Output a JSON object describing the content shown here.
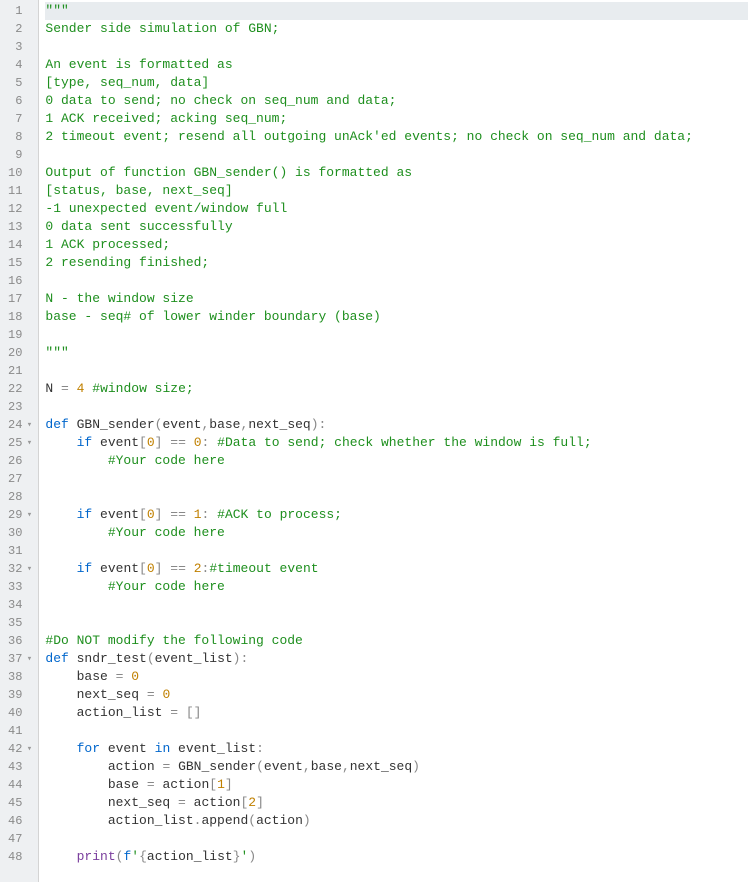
{
  "lines": [
    {
      "num": 1,
      "fold": "",
      "tokens": [
        [
          "str",
          "\"\"\""
        ]
      ]
    },
    {
      "num": 2,
      "fold": "",
      "tokens": [
        [
          "str",
          "Sender side simulation of GBN;"
        ]
      ]
    },
    {
      "num": 3,
      "fold": "",
      "tokens": [
        [
          "str",
          ""
        ]
      ]
    },
    {
      "num": 4,
      "fold": "",
      "tokens": [
        [
          "str",
          "An event is formatted as"
        ]
      ]
    },
    {
      "num": 5,
      "fold": "",
      "tokens": [
        [
          "str",
          "[type, seq_num, data]"
        ]
      ]
    },
    {
      "num": 6,
      "fold": "",
      "tokens": [
        [
          "str",
          "0 data to send; no check on seq_num and data;"
        ]
      ]
    },
    {
      "num": 7,
      "fold": "",
      "tokens": [
        [
          "str",
          "1 ACK received; acking seq_num;"
        ]
      ]
    },
    {
      "num": 8,
      "fold": "",
      "tokens": [
        [
          "str",
          "2 timeout event; resend all outgoing unAck'ed events; no check on seq_num and data;"
        ]
      ]
    },
    {
      "num": 9,
      "fold": "",
      "tokens": [
        [
          "str",
          ""
        ]
      ]
    },
    {
      "num": 10,
      "fold": "",
      "tokens": [
        [
          "str",
          "Output of function GBN_sender() is formatted as"
        ]
      ]
    },
    {
      "num": 11,
      "fold": "",
      "tokens": [
        [
          "str",
          "[status, base, next_seq]"
        ]
      ]
    },
    {
      "num": 12,
      "fold": "",
      "tokens": [
        [
          "str",
          "-1 unexpected event/window full"
        ]
      ]
    },
    {
      "num": 13,
      "fold": "",
      "tokens": [
        [
          "str",
          "0 data sent successfully"
        ]
      ]
    },
    {
      "num": 14,
      "fold": "",
      "tokens": [
        [
          "str",
          "1 ACK processed;"
        ]
      ]
    },
    {
      "num": 15,
      "fold": "",
      "tokens": [
        [
          "str",
          "2 resending finished;"
        ]
      ]
    },
    {
      "num": 16,
      "fold": "",
      "tokens": [
        [
          "str",
          ""
        ]
      ]
    },
    {
      "num": 17,
      "fold": "",
      "tokens": [
        [
          "str",
          "N - the window size"
        ]
      ]
    },
    {
      "num": 18,
      "fold": "",
      "tokens": [
        [
          "str",
          "base - seq# of lower winder boundary (base)"
        ]
      ]
    },
    {
      "num": 19,
      "fold": "",
      "tokens": [
        [
          "str",
          ""
        ]
      ]
    },
    {
      "num": 20,
      "fold": "",
      "tokens": [
        [
          "str",
          "\"\"\""
        ]
      ]
    },
    {
      "num": 21,
      "fold": "",
      "tokens": []
    },
    {
      "num": 22,
      "fold": "",
      "tokens": [
        [
          "var",
          "N "
        ],
        [
          "op",
          "="
        ],
        [
          "var",
          " "
        ],
        [
          "num",
          "4"
        ],
        [
          "var",
          " "
        ],
        [
          "comment",
          "#window size;"
        ]
      ]
    },
    {
      "num": 23,
      "fold": "",
      "tokens": []
    },
    {
      "num": 24,
      "fold": "▾",
      "tokens": [
        [
          "kw",
          "def"
        ],
        [
          "var",
          " "
        ],
        [
          "fn",
          "GBN_sender"
        ],
        [
          "paren",
          "("
        ],
        [
          "var",
          "event"
        ],
        [
          "op",
          ","
        ],
        [
          "var",
          "base"
        ],
        [
          "op",
          ","
        ],
        [
          "var",
          "next_seq"
        ],
        [
          "paren",
          ")"
        ],
        [
          "op",
          ":"
        ]
      ]
    },
    {
      "num": 25,
      "fold": "▾",
      "tokens": [
        [
          "var",
          "    "
        ],
        [
          "kw",
          "if"
        ],
        [
          "var",
          " event"
        ],
        [
          "bracket",
          "["
        ],
        [
          "num",
          "0"
        ],
        [
          "bracket",
          "]"
        ],
        [
          "var",
          " "
        ],
        [
          "op",
          "=="
        ],
        [
          "var",
          " "
        ],
        [
          "num",
          "0"
        ],
        [
          "op",
          ":"
        ],
        [
          "var",
          " "
        ],
        [
          "comment",
          "#Data to send; check whether the window is full;"
        ]
      ]
    },
    {
      "num": 26,
      "fold": "",
      "tokens": [
        [
          "var",
          "        "
        ],
        [
          "comment",
          "#Your code here"
        ]
      ]
    },
    {
      "num": 27,
      "fold": "",
      "tokens": []
    },
    {
      "num": 28,
      "fold": "",
      "tokens": []
    },
    {
      "num": 29,
      "fold": "▾",
      "tokens": [
        [
          "var",
          "    "
        ],
        [
          "kw",
          "if"
        ],
        [
          "var",
          " event"
        ],
        [
          "bracket",
          "["
        ],
        [
          "num",
          "0"
        ],
        [
          "bracket",
          "]"
        ],
        [
          "var",
          " "
        ],
        [
          "op",
          "=="
        ],
        [
          "var",
          " "
        ],
        [
          "num",
          "1"
        ],
        [
          "op",
          ":"
        ],
        [
          "var",
          " "
        ],
        [
          "comment",
          "#ACK to process;"
        ]
      ]
    },
    {
      "num": 30,
      "fold": "",
      "tokens": [
        [
          "var",
          "        "
        ],
        [
          "comment",
          "#Your code here"
        ]
      ]
    },
    {
      "num": 31,
      "fold": "",
      "tokens": []
    },
    {
      "num": 32,
      "fold": "▾",
      "tokens": [
        [
          "var",
          "    "
        ],
        [
          "kw",
          "if"
        ],
        [
          "var",
          " event"
        ],
        [
          "bracket",
          "["
        ],
        [
          "num",
          "0"
        ],
        [
          "bracket",
          "]"
        ],
        [
          "var",
          " "
        ],
        [
          "op",
          "=="
        ],
        [
          "var",
          " "
        ],
        [
          "num",
          "2"
        ],
        [
          "op",
          ":"
        ],
        [
          "comment",
          "#timeout event"
        ]
      ]
    },
    {
      "num": 33,
      "fold": "",
      "tokens": [
        [
          "var",
          "        "
        ],
        [
          "comment",
          "#Your code here"
        ]
      ]
    },
    {
      "num": 34,
      "fold": "",
      "tokens": []
    },
    {
      "num": 35,
      "fold": "",
      "tokens": []
    },
    {
      "num": 36,
      "fold": "",
      "tokens": [
        [
          "comment",
          "#Do NOT modify the following code"
        ]
      ]
    },
    {
      "num": 37,
      "fold": "▾",
      "tokens": [
        [
          "kw",
          "def"
        ],
        [
          "var",
          " "
        ],
        [
          "fn",
          "sndr_test"
        ],
        [
          "paren",
          "("
        ],
        [
          "var",
          "event_list"
        ],
        [
          "paren",
          ")"
        ],
        [
          "op",
          ":"
        ]
      ]
    },
    {
      "num": 38,
      "fold": "",
      "tokens": [
        [
          "var",
          "    base "
        ],
        [
          "op",
          "="
        ],
        [
          "var",
          " "
        ],
        [
          "num",
          "0"
        ]
      ]
    },
    {
      "num": 39,
      "fold": "",
      "tokens": [
        [
          "var",
          "    next_seq "
        ],
        [
          "op",
          "="
        ],
        [
          "var",
          " "
        ],
        [
          "num",
          "0"
        ]
      ]
    },
    {
      "num": 40,
      "fold": "",
      "tokens": [
        [
          "var",
          "    action_list "
        ],
        [
          "op",
          "="
        ],
        [
          "var",
          " "
        ],
        [
          "bracket",
          "[]"
        ]
      ]
    },
    {
      "num": 41,
      "fold": "",
      "tokens": []
    },
    {
      "num": 42,
      "fold": "▾",
      "tokens": [
        [
          "var",
          "    "
        ],
        [
          "kw",
          "for"
        ],
        [
          "var",
          " event "
        ],
        [
          "kw",
          "in"
        ],
        [
          "var",
          " event_list"
        ],
        [
          "op",
          ":"
        ]
      ]
    },
    {
      "num": 43,
      "fold": "",
      "tokens": [
        [
          "var",
          "        action "
        ],
        [
          "op",
          "="
        ],
        [
          "var",
          " "
        ],
        [
          "fn",
          "GBN_sender"
        ],
        [
          "paren",
          "("
        ],
        [
          "var",
          "event"
        ],
        [
          "op",
          ","
        ],
        [
          "var",
          "base"
        ],
        [
          "op",
          ","
        ],
        [
          "var",
          "next_seq"
        ],
        [
          "paren",
          ")"
        ]
      ]
    },
    {
      "num": 44,
      "fold": "",
      "tokens": [
        [
          "var",
          "        base "
        ],
        [
          "op",
          "="
        ],
        [
          "var",
          " action"
        ],
        [
          "bracket",
          "["
        ],
        [
          "num",
          "1"
        ],
        [
          "bracket",
          "]"
        ]
      ]
    },
    {
      "num": 45,
      "fold": "",
      "tokens": [
        [
          "var",
          "        next_seq "
        ],
        [
          "op",
          "="
        ],
        [
          "var",
          " action"
        ],
        [
          "bracket",
          "["
        ],
        [
          "num",
          "2"
        ],
        [
          "bracket",
          "]"
        ]
      ]
    },
    {
      "num": 46,
      "fold": "",
      "tokens": [
        [
          "var",
          "        action_list"
        ],
        [
          "op",
          "."
        ],
        [
          "fn",
          "append"
        ],
        [
          "paren",
          "("
        ],
        [
          "var",
          "action"
        ],
        [
          "paren",
          ")"
        ]
      ]
    },
    {
      "num": 47,
      "fold": "",
      "tokens": []
    },
    {
      "num": 48,
      "fold": "",
      "tokens": [
        [
          "var",
          "    "
        ],
        [
          "builtin",
          "print"
        ],
        [
          "paren",
          "("
        ],
        [
          "fstr",
          "f"
        ],
        [
          "str",
          "'"
        ],
        [
          "op",
          "{"
        ],
        [
          "var",
          "action_list"
        ],
        [
          "op",
          "}"
        ],
        [
          "str",
          "'"
        ],
        [
          "paren",
          ")"
        ]
      ]
    }
  ]
}
